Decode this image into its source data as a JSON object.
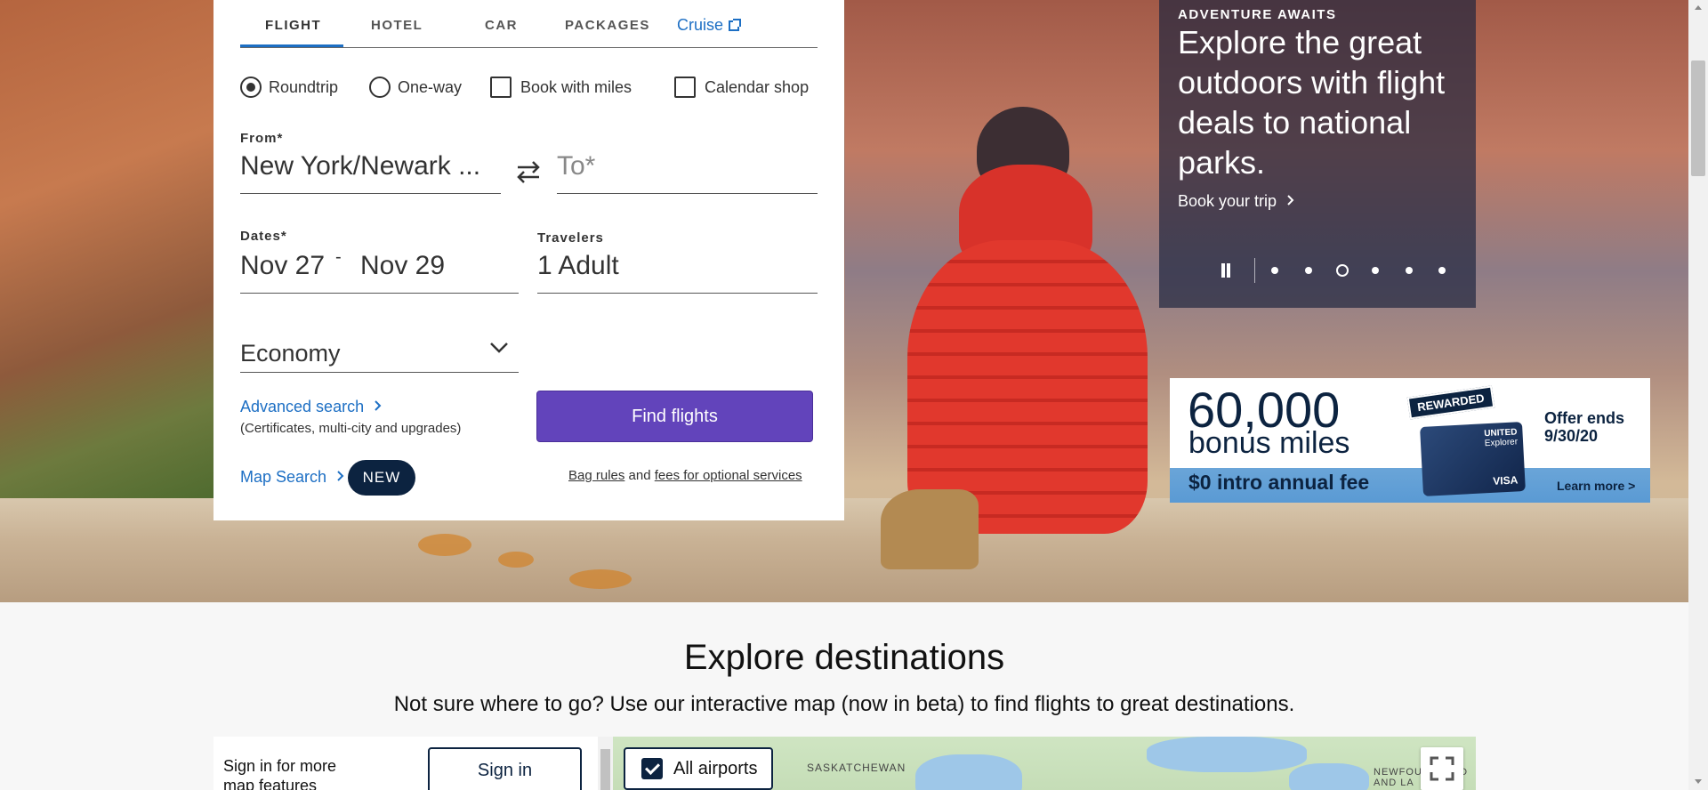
{
  "booking": {
    "tabs": [
      {
        "label": "FLIGHT"
      },
      {
        "label": "HOTEL"
      },
      {
        "label": "CAR"
      },
      {
        "label": "PACKAGES"
      },
      {
        "label": "Cruise"
      }
    ],
    "trip_options": {
      "roundtrip": "Roundtrip",
      "oneway": "One-way",
      "miles": "Book with miles",
      "calendar": "Calendar shop"
    },
    "from": {
      "label": "From*",
      "value": "New York/Newark ..."
    },
    "to": {
      "placeholder": "To*"
    },
    "dates": {
      "label": "Dates*",
      "depart": "Nov 27",
      "separator": "-",
      "return": "Nov 29"
    },
    "travelers": {
      "label": "Travelers",
      "value": "1 Adult"
    },
    "cabin": {
      "value": "Economy"
    },
    "advanced_search": {
      "label": "Advanced search",
      "note": "(Certificates, multi-city and upgrades)"
    },
    "find_flights": "Find flights",
    "map_search": {
      "label": "Map Search",
      "badge": "NEW"
    },
    "bag_rules": {
      "link1": "Bag rules",
      "joiner": "and",
      "link2": "fees for optional services"
    }
  },
  "promo": {
    "eyebrow": "ADVENTURE AWAITS",
    "headline": "Explore the great outdoors with flight deals to national parks.",
    "cta": "Book your trip",
    "carousel": {
      "slides": 6,
      "active_index": 2
    }
  },
  "card_ad": {
    "amount": "60,000",
    "unit": "bonus miles",
    "fee": "$0 intro annual fee",
    "offer": "Offer ends 9/30/20",
    "learn_more": "Learn more >",
    "badge": "REWARDED",
    "card_brand": "UNITED",
    "card_name": "Explorer",
    "card_network": "VISA"
  },
  "explore": {
    "title": "Explore destinations",
    "subtitle": "Not sure where to go? Use our interactive map (now in beta) to find flights to great destinations.",
    "signin_prompt": "Sign in for more map features",
    "signin_button": "Sign in",
    "all_airports": "All airports",
    "map_labels": {
      "saskatchewan": "SASKATCHEWAN",
      "newfoundland": "NEWFOUNDLAND AND LA"
    }
  },
  "colors": {
    "accent": "#1d6fc4",
    "button": "#6244bb",
    "navy": "#0c2340"
  }
}
